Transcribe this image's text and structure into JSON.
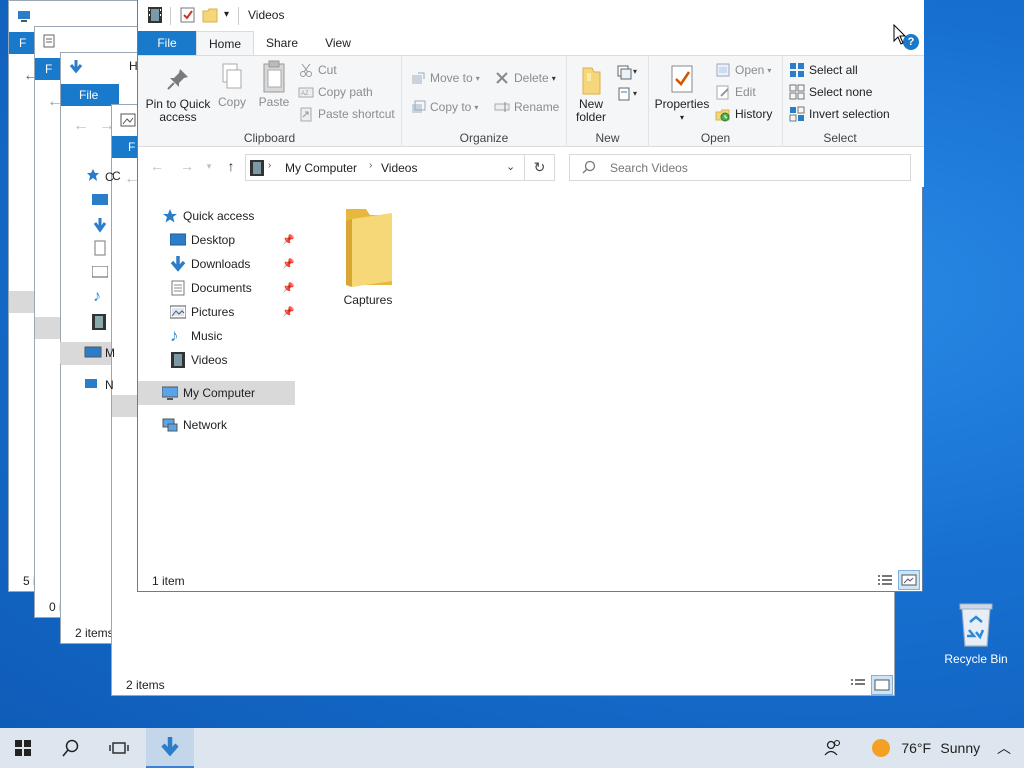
{
  "desktop": {
    "recycle_bin_label": "Recycle Bin"
  },
  "bg_windows": {
    "w1": {
      "status": "5 i",
      "file_tab": "F"
    },
    "w2": {
      "status": "0 i",
      "file_tab": "F"
    },
    "w3": {
      "status": "2 items",
      "file_tab": "File",
      "home_tab": "H"
    },
    "w4": {
      "status": "2 items",
      "file_tab": "F",
      "nav_letters": [
        "C",
        "M",
        "N"
      ]
    }
  },
  "window": {
    "title": "Videos",
    "tabs": {
      "file": "File",
      "home": "Home",
      "share": "Share",
      "view": "View"
    },
    "ribbon": {
      "clipboard": {
        "label": "Clipboard",
        "pin_to_quick_access": "Pin to Quick access",
        "pin_line1": "Pin to Quick",
        "pin_line2": "access",
        "copy": "Copy",
        "paste": "Paste",
        "cut": "Cut",
        "copy_path": "Copy path",
        "paste_shortcut": "Paste shortcut"
      },
      "organize": {
        "label": "Organize",
        "move_to": "Move to",
        "copy_to": "Copy to",
        "delete": "Delete",
        "rename": "Rename"
      },
      "new": {
        "label": "New",
        "new_folder_line1": "New",
        "new_folder_line2": "folder"
      },
      "open": {
        "label": "Open",
        "properties": "Properties",
        "open": "Open",
        "edit": "Edit",
        "history": "History"
      },
      "select": {
        "label": "Select",
        "select_all": "Select all",
        "select_none": "Select none",
        "invert_selection": "Invert selection"
      }
    },
    "address": {
      "crumbs": [
        "My Computer",
        "Videos"
      ],
      "search_placeholder": "Search Videos"
    },
    "nav": {
      "quick_access": "Quick access",
      "items": [
        "Desktop",
        "Downloads",
        "Documents",
        "Pictures",
        "Music",
        "Videos"
      ],
      "my_computer": "My Computer",
      "network": "Network"
    },
    "content": {
      "items": [
        {
          "name": "Captures",
          "type": "folder"
        }
      ]
    },
    "status": "1 item"
  },
  "taskbar": {
    "weather_temp": "76°F",
    "weather_desc": "Sunny"
  },
  "colors": {
    "accent": "#1979ca",
    "folder": "#f5c542",
    "taskbar": "#dde6ef"
  }
}
